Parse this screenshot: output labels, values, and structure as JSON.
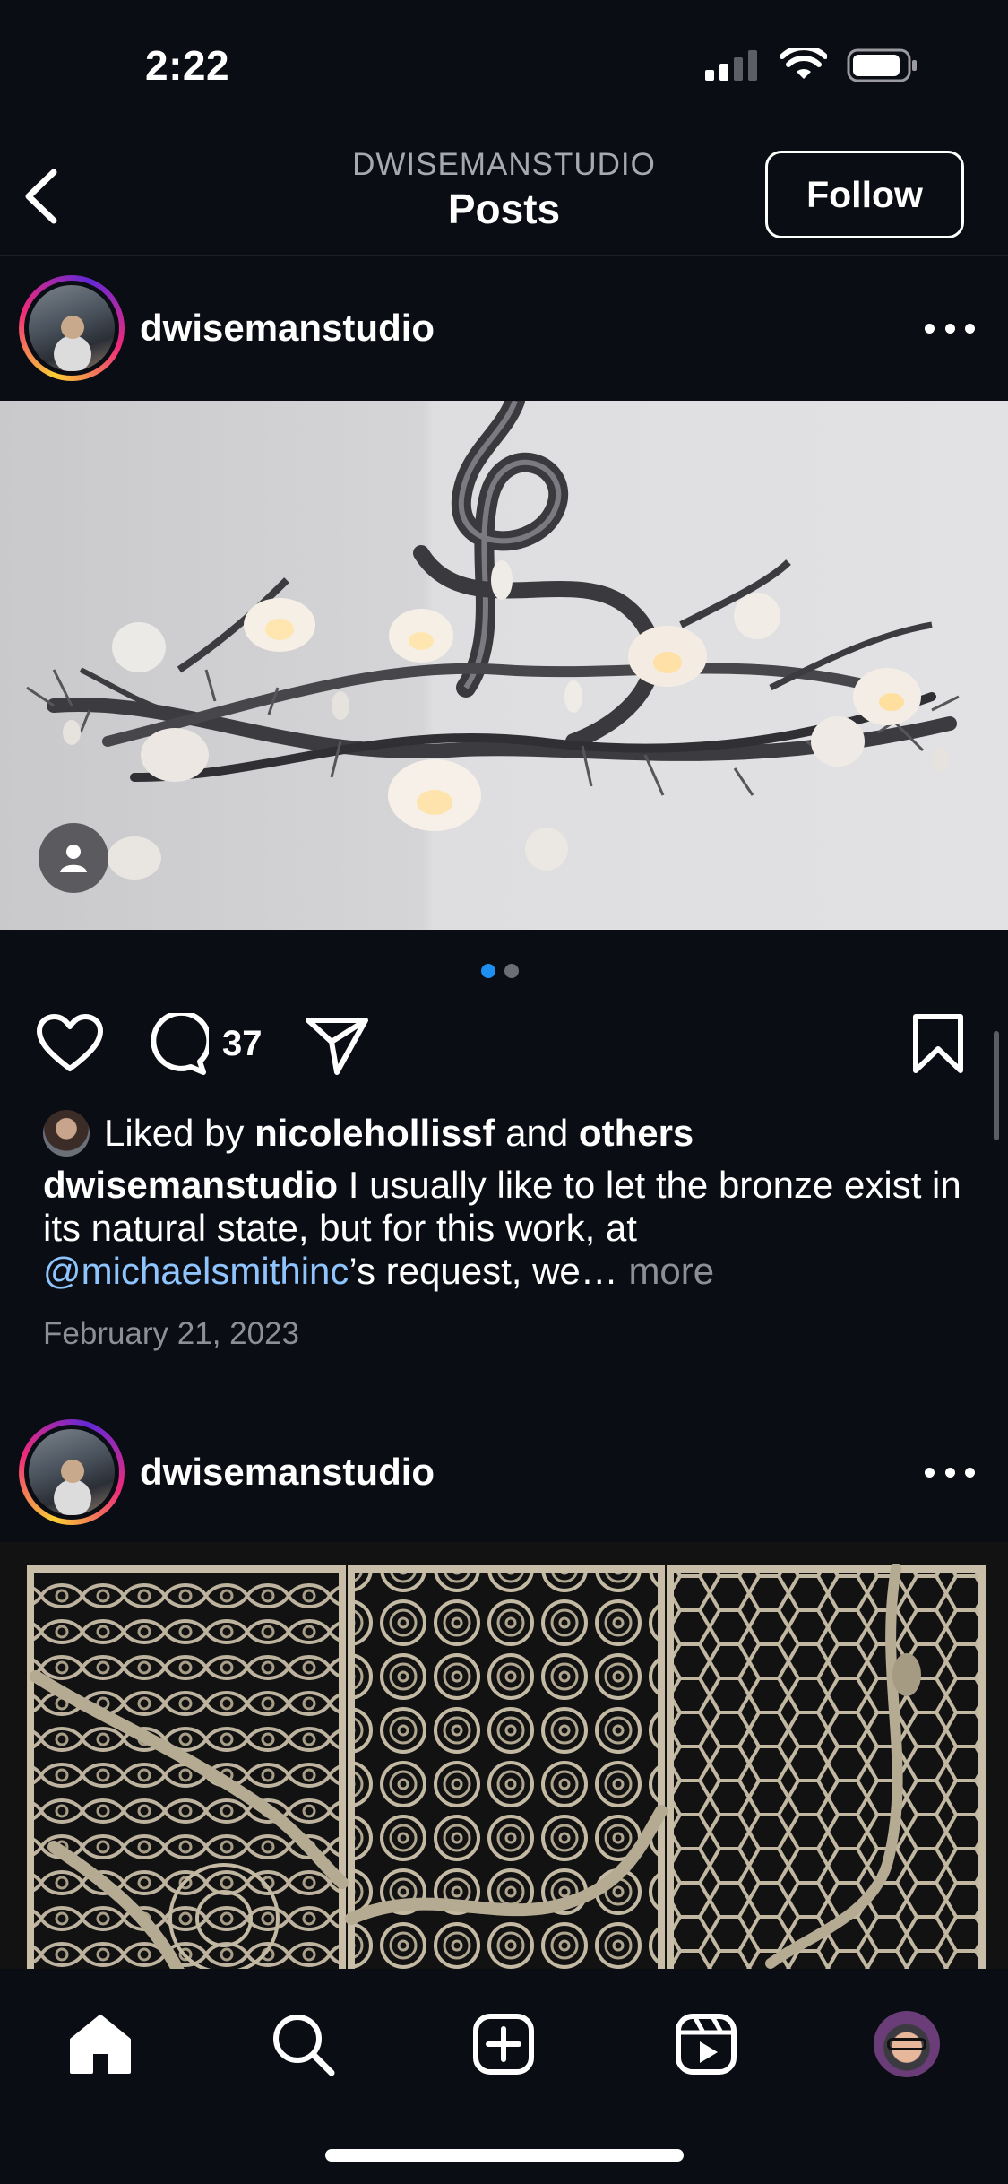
{
  "status_bar": {
    "time": "2:22"
  },
  "header": {
    "subtitle": "DWISEMANSTUDIO",
    "title": "Posts",
    "follow_label": "Follow"
  },
  "post1": {
    "username": "dwisemanstudio",
    "carousel": {
      "count": 2,
      "active": 1
    },
    "comment_count": "37",
    "liked_by": {
      "prefix": "Liked by",
      "user": "nicolehollissf",
      "and": "and",
      "others": "others"
    },
    "caption": {
      "username": "dwisemanstudio",
      "text_1": " I usually like to let the bronze exist in its natural state, but for this work, at ",
      "mention": "@michaelsmithinc",
      "text_2": "’s request, we… ",
      "more": "more"
    },
    "date": "February 21, 2023"
  },
  "post2": {
    "username": "dwisemanstudio"
  },
  "colors": {
    "background": "#0b0d14",
    "accent": "#1f8ef1",
    "mention": "#8ec5ff"
  },
  "tabs": [
    "home-icon",
    "search-icon",
    "create-icon",
    "reels-icon",
    "profile-avatar"
  ]
}
